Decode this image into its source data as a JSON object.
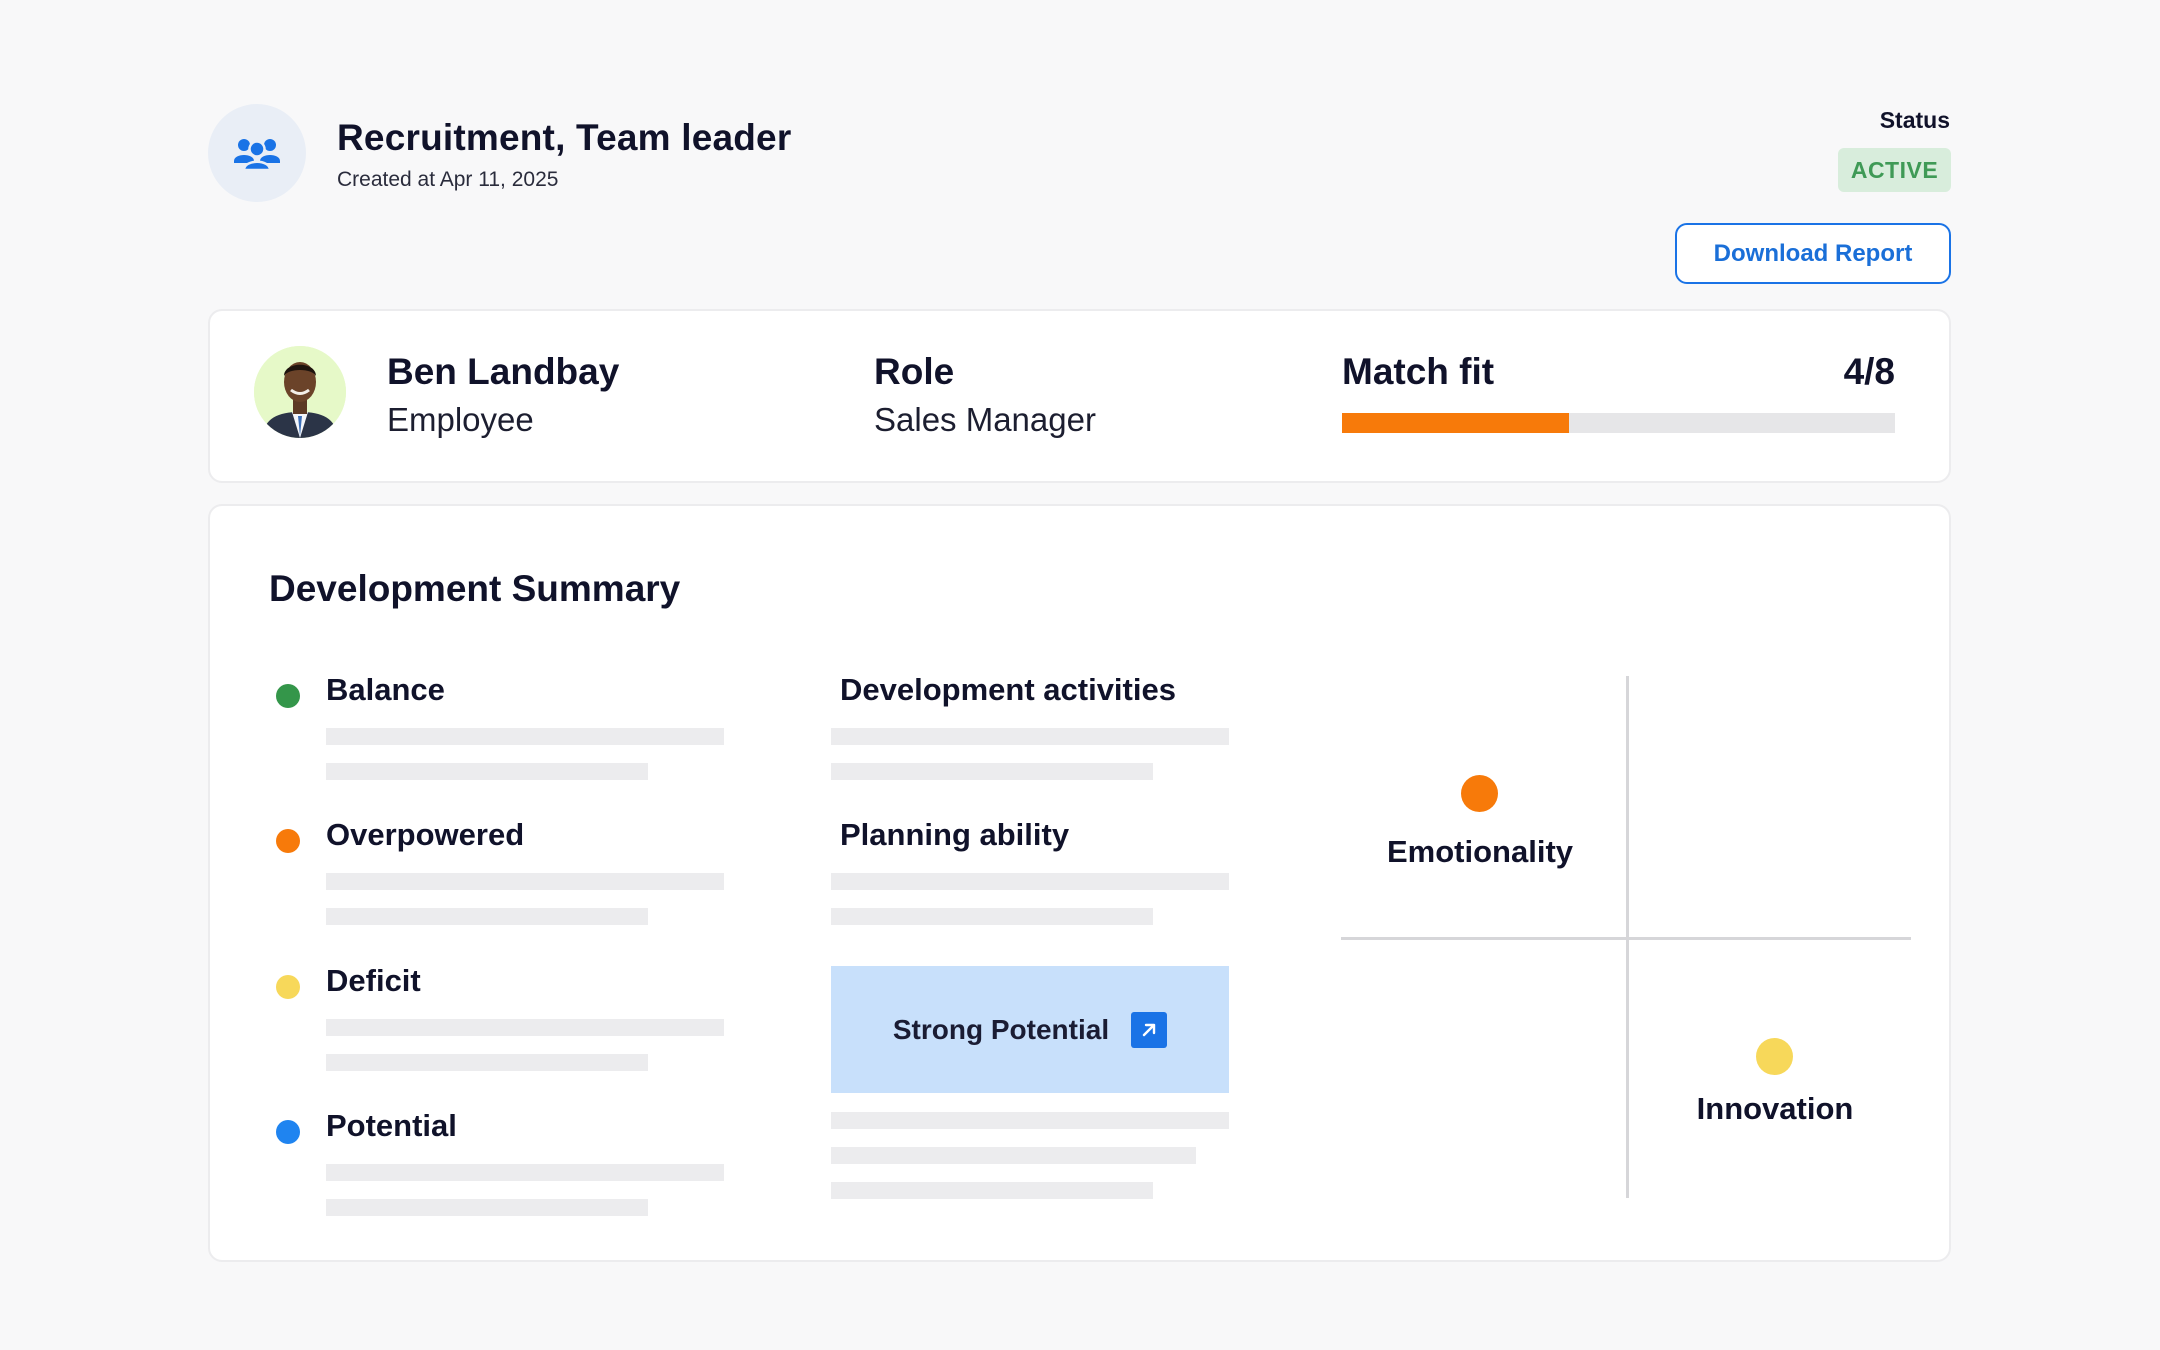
{
  "header": {
    "title": "Recruitment, Team leader",
    "created": "Created at Apr 11, 2025",
    "icon": "team-icon",
    "status_label": "Status",
    "status_value": "ACTIVE",
    "status_color": "#3f9a56",
    "download_label": "Download Report"
  },
  "candidate": {
    "name": "Ben Landbay",
    "type": "Employee",
    "role_label": "Role",
    "role_value": "Sales Manager",
    "match_label": "Match fit",
    "match_score": "4/8",
    "match_fraction": 0.41,
    "match_color": "#f77a0a"
  },
  "summary": {
    "title": "Development Summary",
    "legend": [
      {
        "label": "Balance",
        "color": "#34964a"
      },
      {
        "label": "Overpowered",
        "color": "#f77a0a"
      },
      {
        "label": "Deficit",
        "color": "#f7d85a"
      },
      {
        "label": "Potential",
        "color": "#1f84f0"
      }
    ],
    "activities": [
      {
        "label": "Development activities"
      },
      {
        "label": "Planning ability"
      }
    ],
    "potential_button": "Strong Potential",
    "quadrant": [
      {
        "label": "Emotionality",
        "color": "#f77a0a"
      },
      {
        "label": "Innovation",
        "color": "#f7d85a"
      }
    ]
  }
}
